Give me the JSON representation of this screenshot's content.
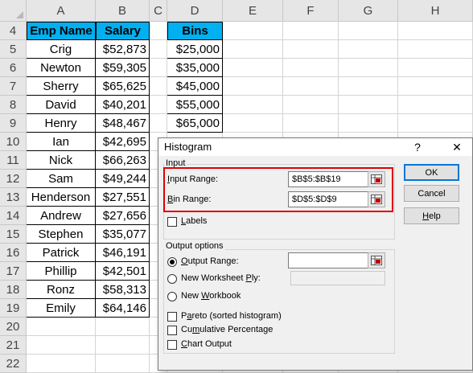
{
  "columns": [
    "A",
    "B",
    "C",
    "D",
    "E",
    "F",
    "G",
    "H"
  ],
  "rows": [
    "4",
    "5",
    "6",
    "7",
    "8",
    "9",
    "10",
    "11",
    "12",
    "13",
    "14",
    "15",
    "16",
    "17",
    "18",
    "19",
    "20",
    "21",
    "22"
  ],
  "headers": {
    "emp_name": "Emp Name",
    "salary": "Salary",
    "bins": "Bins"
  },
  "employees": [
    {
      "name": "Crig",
      "salary": "$52,873"
    },
    {
      "name": "Newton",
      "salary": "$59,305"
    },
    {
      "name": "Sherry",
      "salary": "$65,625"
    },
    {
      "name": "David",
      "salary": "$40,201"
    },
    {
      "name": "Henry",
      "salary": "$48,467"
    },
    {
      "name": "Ian",
      "salary": "$42,695"
    },
    {
      "name": "Nick",
      "salary": "$66,263"
    },
    {
      "name": "Sam",
      "salary": "$49,244"
    },
    {
      "name": "Henderson",
      "salary": "$27,551"
    },
    {
      "name": "Andrew",
      "salary": "$27,656"
    },
    {
      "name": "Stephen",
      "salary": "$35,077"
    },
    {
      "name": "Patrick",
      "salary": "$46,191"
    },
    {
      "name": "Phillip",
      "salary": "$42,501"
    },
    {
      "name": "Ronz",
      "salary": "$58,313"
    },
    {
      "name": "Emily",
      "salary": "$64,146"
    }
  ],
  "bins": [
    "$25,000",
    "$35,000",
    "$45,000",
    "$55,000",
    "$65,000"
  ],
  "dialog": {
    "title": "Histogram",
    "help_glyph": "?",
    "close_glyph": "✕",
    "input_group": "Input",
    "input_range": {
      "key": "I",
      "rest": "nput Range:",
      "value": "$B$5:$B$19"
    },
    "bin_range": {
      "key": "B",
      "rest": "in Range:",
      "value": "$D$5:$D$9"
    },
    "labels": {
      "key": "L",
      "rest": "abels",
      "checked": false
    },
    "output_group": "Output options",
    "output_range": {
      "key": "O",
      "rest": "utput Range:",
      "value": "",
      "selected": true
    },
    "new_ply": {
      "pre": "New Worksheet ",
      "key": "P",
      "rest": "ly:",
      "value": "",
      "selected": false
    },
    "new_workbook": {
      "pre": "New ",
      "key": "W",
      "rest": "orkbook",
      "selected": false
    },
    "pareto": {
      "pre": "P",
      "key": "a",
      "rest": "reto (sorted histogram)",
      "checked": false
    },
    "cumulative": {
      "pre": "Cu",
      "key": "m",
      "rest": "ulative Percentage",
      "checked": false
    },
    "chart": {
      "key": "C",
      "rest": "hart Output",
      "checked": false
    },
    "ok": "OK",
    "cancel": "Cancel",
    "help": {
      "key": "H",
      "rest": "elp"
    }
  },
  "colors": {
    "header_fill": "#00b0f0",
    "highlight": "#e00000"
  }
}
